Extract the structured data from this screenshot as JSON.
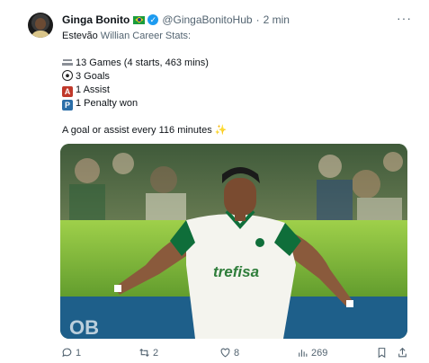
{
  "header": {
    "name": "Ginga Bonito",
    "handle": "@GingaBonitoHub",
    "separator": "·",
    "time": "2 min",
    "more": "···"
  },
  "post": {
    "title_name": "Estevão",
    "title_rest": " Willian Career Stats:",
    "stats": [
      {
        "icon": "stadium-icon",
        "text": "13 Games (4 starts, 463 mins)"
      },
      {
        "icon": "soccer-ball-icon",
        "text": "3 Goals"
      },
      {
        "icon": "assist-icon",
        "badge": "A",
        "text": "1 Assist"
      },
      {
        "icon": "penalty-icon",
        "badge": "P",
        "text": "1 Penalty won"
      }
    ],
    "summary": "A goal or assist every 116 minutes"
  },
  "media": {
    "jersey_sponsor": "trefisa"
  },
  "actions": {
    "replies": "1",
    "reposts": "2",
    "likes": "8",
    "views": "269"
  },
  "colors": {
    "verified": "#1d9bf0",
    "muted_text": "#536471",
    "jersey_green": "#0f6e3a",
    "pitch_green": "#8cc43a"
  }
}
